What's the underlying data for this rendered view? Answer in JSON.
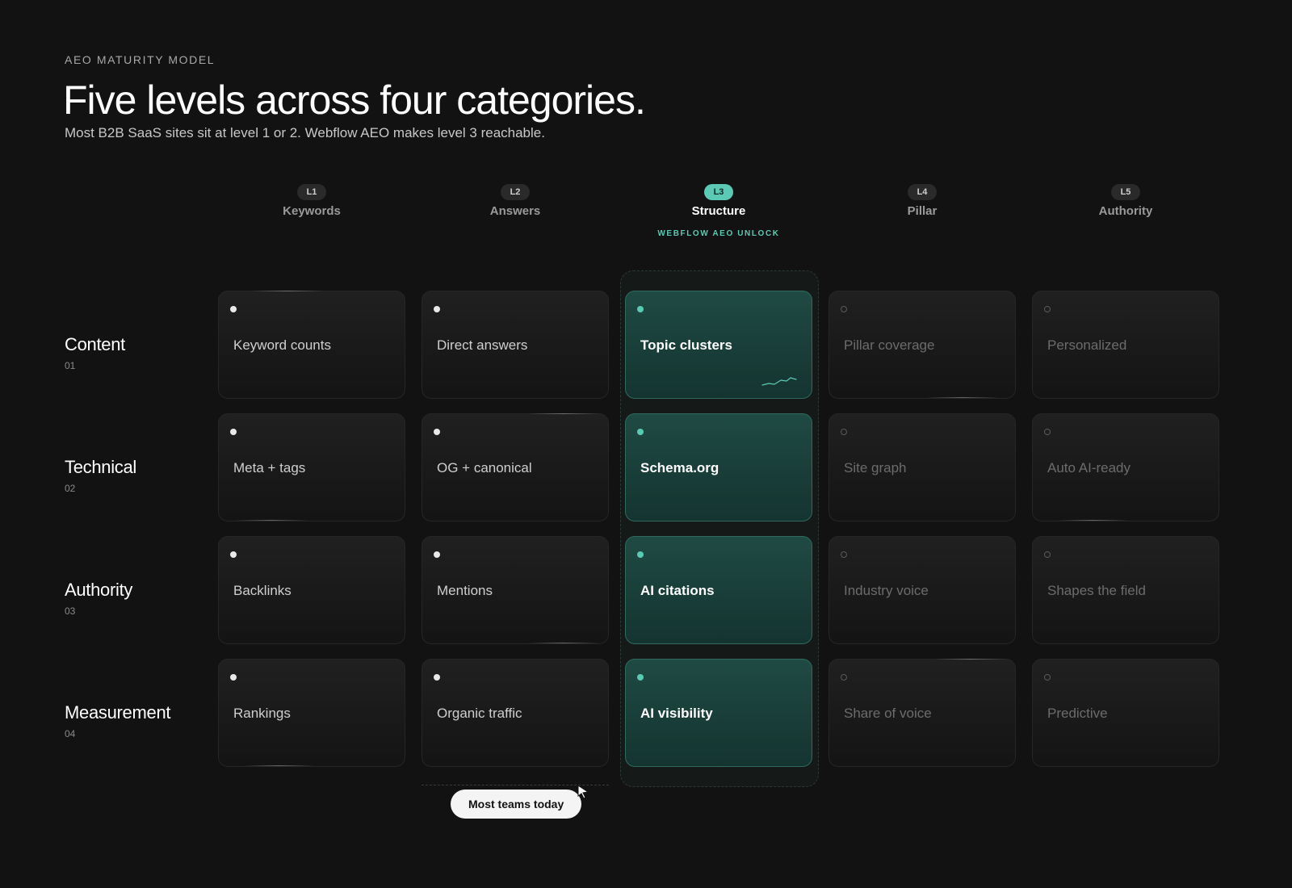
{
  "header": {
    "eyebrow": "AEO MATURITY MODEL",
    "title": "Five levels across four categories.",
    "subtitle": "Most B2B SaaS sites sit at level 1 or 2. Webflow AEO makes level 3 reachable."
  },
  "levels": [
    {
      "badge": "L1",
      "name": "Keywords"
    },
    {
      "badge": "L2",
      "name": "Answers"
    },
    {
      "badge": "L3",
      "name": "Structure",
      "unlock": "WEBFLOW AEO UNLOCK"
    },
    {
      "badge": "L4",
      "name": "Pillar"
    },
    {
      "badge": "L5",
      "name": "Authority"
    }
  ],
  "rows": [
    {
      "title": "Content",
      "num": "01",
      "cells": [
        "Keyword counts",
        "Direct answers",
        "Topic clusters",
        "Pillar coverage",
        "Personalized"
      ]
    },
    {
      "title": "Technical",
      "num": "02",
      "cells": [
        "Meta + tags",
        "OG + canonical",
        "Schema.org",
        "Site graph",
        "Auto AI-ready"
      ]
    },
    {
      "title": "Authority",
      "num": "03",
      "cells": [
        "Backlinks",
        "Mentions",
        "AI citations",
        "Industry voice",
        "Shapes the field"
      ]
    },
    {
      "title": "Measurement",
      "num": "04",
      "cells": [
        "Rankings",
        "Organic traffic",
        "AI visibility",
        "Share of voice",
        "Predictive"
      ]
    }
  ],
  "marker": {
    "label": "Most teams today"
  },
  "colors": {
    "accent": "#5cc9b4",
    "background": "#121212"
  }
}
